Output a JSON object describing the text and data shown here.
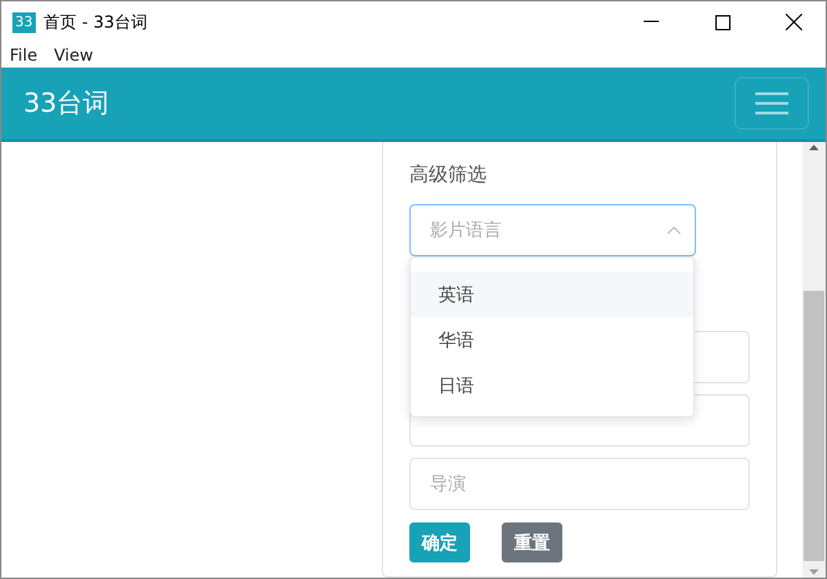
{
  "window": {
    "icon": "33",
    "title": "首页 - 33台词"
  },
  "menu": [
    "File",
    "View"
  ],
  "navbar": {
    "brand": "33台词"
  },
  "filter": {
    "heading": "高级筛选",
    "select": {
      "placeholder": "影片语言",
      "expanded": true
    },
    "options": [
      {
        "label": "英语",
        "highlighted": true
      },
      {
        "label": "华语",
        "highlighted": false
      },
      {
        "label": "日语",
        "highlighted": false
      }
    ],
    "fields": [
      {
        "kind": "input"
      },
      {
        "kind": "input"
      },
      {
        "kind": "input",
        "placeholder": "导演"
      }
    ],
    "buttons": [
      {
        "label": "确定",
        "kind": "primary"
      },
      {
        "label": "重置",
        "kind": "secondary"
      }
    ]
  }
}
